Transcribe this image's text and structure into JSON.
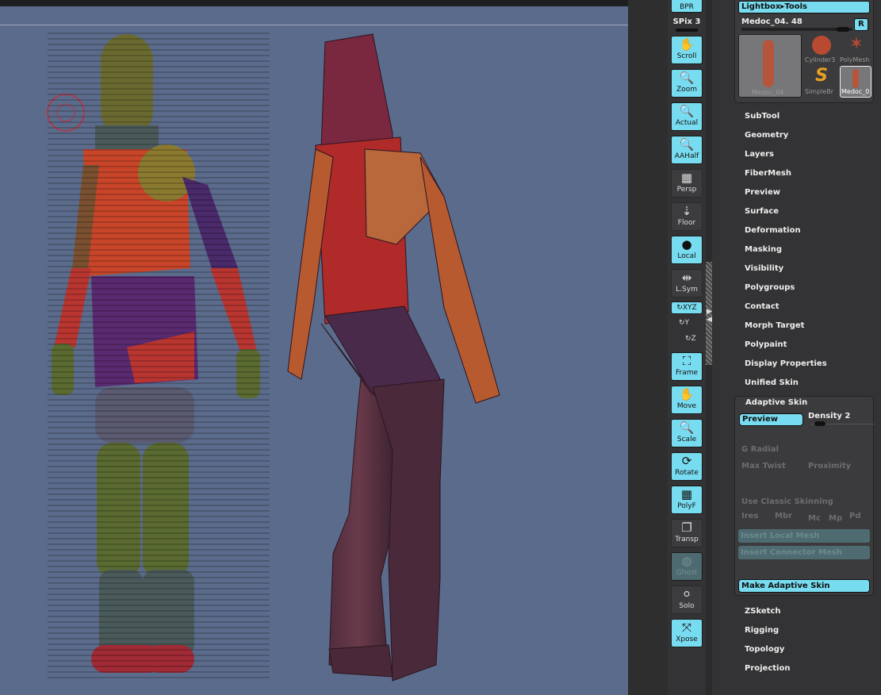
{
  "viewport": {
    "background": "#5b6b8b",
    "brush_cursor": "brush-circle"
  },
  "toolbar": {
    "spix": "SPix 3",
    "buttons": [
      {
        "label": "BPR",
        "icon": "bpr-icon",
        "state": "on"
      },
      {
        "label": "Scroll",
        "icon": "hand-scroll-icon",
        "state": "on"
      },
      {
        "label": "Zoom",
        "icon": "magnifier-zoom-icon",
        "state": "on"
      },
      {
        "label": "Actual",
        "icon": "magnifier-actual-icon",
        "state": "on"
      },
      {
        "label": "AAHalf",
        "icon": "magnifier-aahalf-icon",
        "state": "on"
      },
      {
        "label": "Persp",
        "icon": "perspective-grid-icon",
        "state": "off"
      },
      {
        "label": "Floor",
        "icon": "floor-icon",
        "state": "off"
      },
      {
        "label": "Local",
        "icon": "local-icon",
        "state": "on"
      },
      {
        "label": "L.Sym",
        "icon": "symmetry-icon",
        "state": "off"
      },
      {
        "label": "XYZ",
        "icon": "rotate-xyz-icon",
        "state": "on"
      },
      {
        "label": "Y",
        "icon": "rotate-y-icon",
        "state": "off"
      },
      {
        "label": "Z",
        "icon": "rotate-z-icon",
        "state": "off"
      },
      {
        "label": "Frame",
        "icon": "frame-icon",
        "state": "on"
      },
      {
        "label": "Move",
        "icon": "hand-move-icon",
        "state": "on"
      },
      {
        "label": "Scale",
        "icon": "magnifier-scale-icon",
        "state": "on"
      },
      {
        "label": "Rotate",
        "icon": "rotate-icon",
        "state": "on"
      },
      {
        "label": "PolyF",
        "icon": "polyframe-grid-icon",
        "state": "on"
      },
      {
        "label": "Transp",
        "icon": "transparency-icon",
        "state": "off"
      },
      {
        "label": "Ghost",
        "icon": "ghost-icon",
        "state": "disabled"
      },
      {
        "label": "Solo",
        "icon": "solo-icon",
        "state": "off"
      },
      {
        "label": "Xpose",
        "icon": "xpose-icon",
        "state": "on"
      }
    ]
  },
  "tool_panel": {
    "header": "Lightbox▸Tools",
    "current_tool": "Medoc_04. 48",
    "r_button": "R",
    "thumbnails": [
      {
        "label": "Medoc_04",
        "icon": "figure-thumbnail"
      },
      {
        "label": "Cylinder3",
        "icon": "cylinder-icon"
      },
      {
        "label": "PolyMesh",
        "icon": "star-polymesh-icon"
      },
      {
        "label": "SimpleBr",
        "icon": "simplebrush-s-icon"
      },
      {
        "label": "Medoc_0",
        "icon": "figure-thumbnail"
      }
    ],
    "menus_top": [
      "SubTool",
      "Geometry",
      "Layers",
      "FiberMesh",
      "Preview",
      "Surface",
      "Deformation",
      "Masking",
      "Visibility",
      "Polygroups",
      "Contact",
      "Morph Target",
      "Polypaint",
      "Display Properties",
      "Unified Skin"
    ],
    "adaptive_skin": {
      "title": "Adaptive Skin",
      "preview": "Preview",
      "density": "Density 2",
      "g_radial": "G Radial",
      "max_twist": "Max Twist",
      "proximity": "Proximity",
      "classic": "Use Classic Skinning",
      "ires": "Ires",
      "mbr": "Mbr",
      "mc": "Mc",
      "mp": "Mp",
      "pd": "Pd",
      "insert_local": "Insert Local Mesh",
      "insert_connector": "Insert Connector Mesh",
      "make": "Make Adaptive Skin"
    },
    "menus_bottom": [
      "ZSketch",
      "Rigging",
      "Topology",
      "Projection"
    ]
  },
  "colors": {
    "accent": "#78dcf0",
    "panel": "#333335"
  }
}
